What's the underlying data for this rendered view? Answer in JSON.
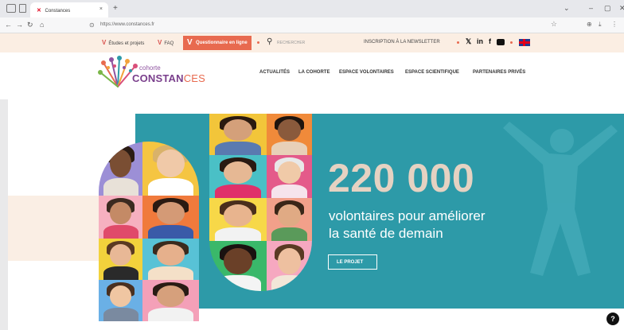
{
  "browser": {
    "tab_title": "Constances",
    "tab_close": "×",
    "new_tab": "+",
    "url": "https://www.constances.fr",
    "win_minimize": "–",
    "win_maximize": "▢",
    "win_close": "✕"
  },
  "topbar": {
    "links": [
      {
        "label": "Études et projets"
      },
      {
        "label": "FAQ"
      }
    ],
    "questionnaire_label": "Questionnaire en ligne",
    "search_label": "RECHERCHER",
    "newsletter_label": "INSCRIPTION À LA NEWSLETTER",
    "social_icons": [
      "x-icon",
      "linkedin-icon",
      "facebook-icon",
      "youtube-icon"
    ],
    "language_icon": "uk-flag-icon"
  },
  "logo": {
    "small": "cohorte",
    "big_main": "CONSTAN",
    "big_accent": "CES"
  },
  "nav": {
    "items": [
      {
        "label": "ACTUALITÉS"
      },
      {
        "label": "LA COHORTE"
      },
      {
        "label": "ESPACE VOLONTAIRES"
      },
      {
        "label": "ESPACE SCIENTIFIQUE"
      },
      {
        "label": "PARTENAIRES PRIVÉS"
      }
    ]
  },
  "hero": {
    "number": "220 000",
    "line1": "volontaires pour améliorer",
    "line2": "la santé de demain",
    "button_label": "LE PROJET"
  },
  "help_badge": "?",
  "colors": {
    "brand_orange": "#e86a4f",
    "brand_purple": "#7a3f8c",
    "hero_teal": "#2d9aa8",
    "number_beige": "#e5d2c2",
    "topbar_bg": "#fbeee3"
  }
}
